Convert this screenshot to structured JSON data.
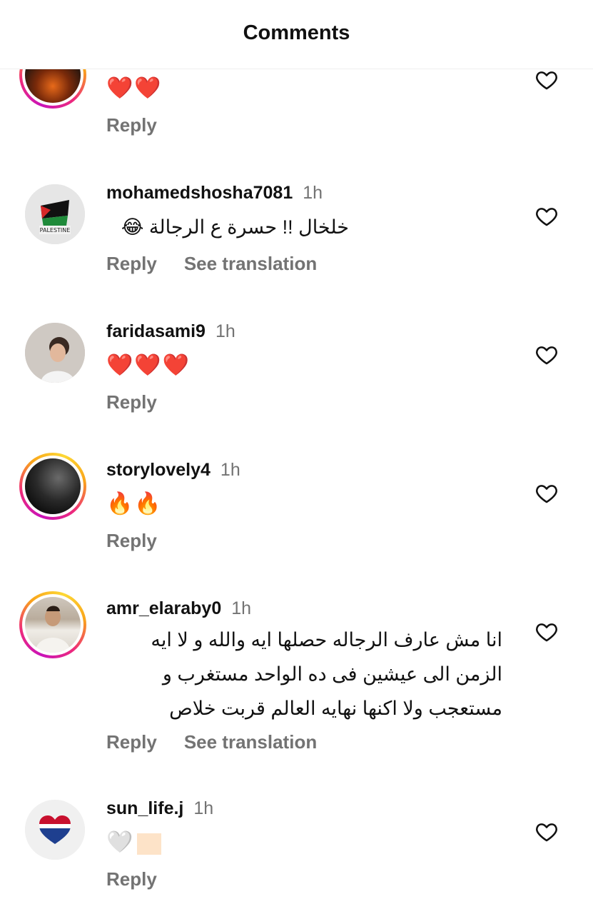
{
  "header": {
    "title": "Comments"
  },
  "comments": [
    {
      "username": "",
      "time": "",
      "text": "❤️❤️",
      "reply": "Reply",
      "translate": ""
    },
    {
      "username": "mohamedshosha7081",
      "time": "1h",
      "text": "خلخال !! حسرة ع الرجالة 😂",
      "reply": "Reply",
      "translate": "See translation",
      "avatar_label": "PALESTINE"
    },
    {
      "username": "faridasami9",
      "time": "1h",
      "text": "❤️❤️❤️",
      "reply": "Reply",
      "translate": ""
    },
    {
      "username": "storylovely4",
      "time": "1h",
      "text": "🔥🔥",
      "reply": "Reply",
      "translate": ""
    },
    {
      "username": "amr_elaraby0",
      "time": "1h",
      "text": "انا مش عارف الرجاله حصلها ايه والله و لا ايه الزمن الى عيشين فى ده الواحد مستغرب و مستعجب ولا اكنها نهايه العالم قربت خلاص",
      "reply": "Reply",
      "translate": "See translation"
    },
    {
      "username": "sun_life.j",
      "time": "1h",
      "text": "🤍",
      "reply": "Reply",
      "translate": ""
    }
  ],
  "colors": {
    "accent_story": "#ee2a7b",
    "muted": "#737373",
    "heart": "#e8232f"
  },
  "icons": {
    "like": "heart-outline-icon"
  }
}
